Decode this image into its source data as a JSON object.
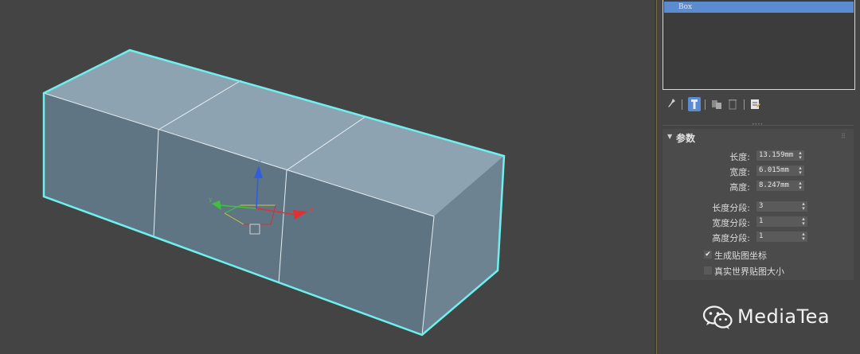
{
  "viewport": {
    "object_name": "Box",
    "selection_color": "#6ef0ee",
    "face_colors": {
      "top": "#8ea3b2",
      "front": "#5f7583",
      "side": "#6d8290"
    },
    "gizmo": {
      "axis_x_label": "x",
      "axis_y_label": "y",
      "axis_z_label": "z"
    }
  },
  "modifier_stack": {
    "items": [
      "Box"
    ],
    "selected_index": 0,
    "highlight_color": "#5b8bd1"
  },
  "stack_toolbar": {
    "icons": [
      "pin-stack-icon",
      "show-end-result-icon",
      "make-unique-icon",
      "remove-modifier-icon",
      "configure-modifier-sets-icon"
    ]
  },
  "parameters": {
    "title": "参数",
    "length_label": "长度:",
    "length_value": "13.159mm",
    "width_label": "宽度:",
    "width_value": "6.015mm",
    "height_label": "高度:",
    "height_value": "8.247mm",
    "length_segs_label": "长度分段:",
    "length_segs_value": "3",
    "width_segs_label": "宽度分段:",
    "width_segs_value": "1",
    "height_segs_label": "高度分段:",
    "height_segs_value": "1",
    "gen_mapping_label": "生成贴图坐标",
    "gen_mapping_checked": true,
    "real_world_label": "真实世界贴图大小",
    "real_world_checked": false
  },
  "watermark": {
    "text": "MediaTea"
  }
}
